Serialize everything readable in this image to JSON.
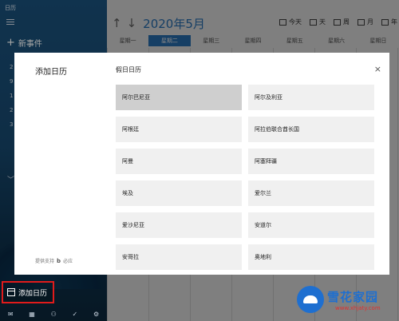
{
  "app": {
    "title": "日历"
  },
  "sidebar": {
    "new_event": "新事件",
    "side_numbers": [
      "2",
      "9",
      "1",
      "2",
      "3"
    ],
    "add_calendar": "添加日历"
  },
  "header": {
    "month": "2020年5月",
    "views": [
      "今天",
      "天",
      "周",
      "月",
      "年"
    ]
  },
  "weekdays": [
    "星期一",
    "星期二",
    "星期三",
    "星期四",
    "星期五",
    "星期六",
    "星期日"
  ],
  "modal": {
    "left_title": "添加日历",
    "section_title": "假日日历",
    "close": "×",
    "powered_by": "提供支持",
    "powered_brand": "必应",
    "items": [
      {
        "label": "阿尔巴尼亚",
        "selected": true
      },
      {
        "label": "阿尔及利亚",
        "selected": false
      },
      {
        "label": "阿根廷",
        "selected": false
      },
      {
        "label": "阿拉伯联合酋长国",
        "selected": false
      },
      {
        "label": "阿曼",
        "selected": false
      },
      {
        "label": "阿塞拜疆",
        "selected": false
      },
      {
        "label": "埃及",
        "selected": false
      },
      {
        "label": "爱尔兰",
        "selected": false
      },
      {
        "label": "爱沙尼亚",
        "selected": false
      },
      {
        "label": "安道尔",
        "selected": false
      },
      {
        "label": "安哥拉",
        "selected": false
      },
      {
        "label": "奥地利",
        "selected": false
      }
    ]
  },
  "watermark": {
    "name": "雪花家园",
    "url": "www.xhjaty.com"
  }
}
